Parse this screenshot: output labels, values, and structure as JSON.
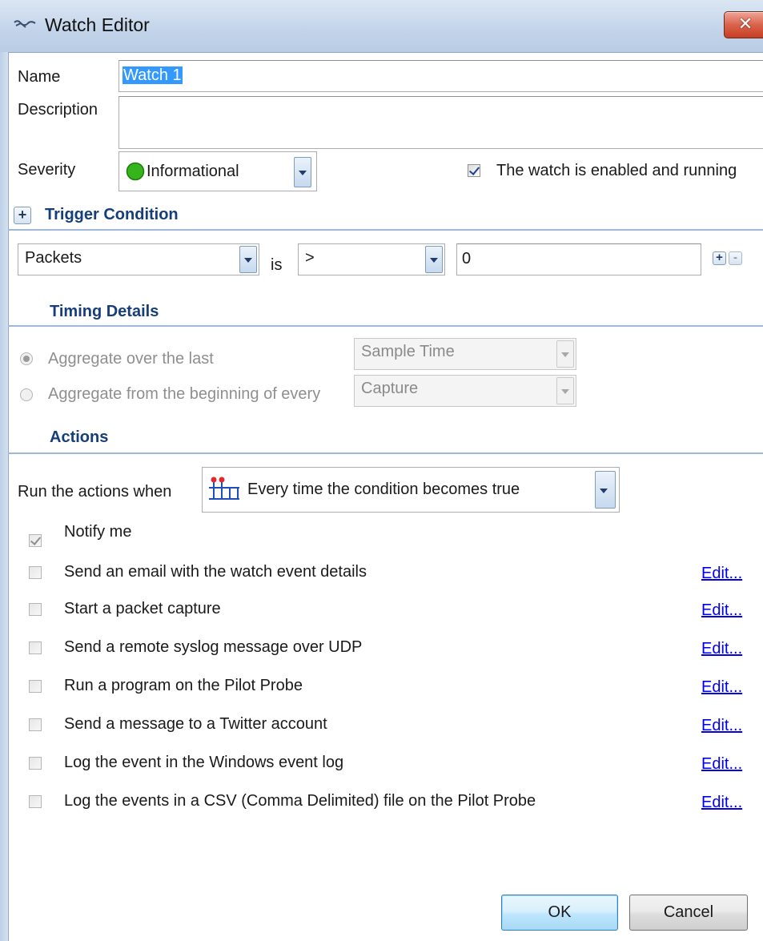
{
  "window": {
    "title": "Watch Editor",
    "close_glyph": "✕"
  },
  "form": {
    "name_label": "Name",
    "name_value": "Watch 1",
    "description_label": "Description",
    "description_value": "",
    "severity_label": "Severity",
    "severity_value": "Informational",
    "severity_color": "#2ea816",
    "enabled_label": "The watch is enabled and running",
    "enabled_checked": true
  },
  "trigger": {
    "toggle_glyph": "+",
    "title": "Trigger Condition",
    "field_value": "Packets",
    "is_label": "is",
    "operator_value": ">",
    "threshold_value": "0",
    "add_glyph": "+",
    "remove_glyph": "-"
  },
  "timing": {
    "title": "Timing Details",
    "option1_label": "Aggregate over the last",
    "option1_value": "Sample Time",
    "option1_selected": true,
    "option2_label": "Aggregate from the beginning of every",
    "option2_value": "Capture",
    "option2_selected": false
  },
  "actions": {
    "title": "Actions",
    "run_when_label": "Run the actions when",
    "run_when_value": "Every time the condition becomes true",
    "notify_label": "Notify me",
    "notify_checked": true,
    "edit_label": "Edit...",
    "items": [
      {
        "label": "Send an email with the watch event details",
        "checked": false
      },
      {
        "label": "Start a packet capture",
        "checked": false
      },
      {
        "label": "Send a remote syslog message over UDP",
        "checked": false
      },
      {
        "label": "Run a program on the Pilot Probe",
        "checked": false
      },
      {
        "label": "Send a message to a Twitter account",
        "checked": false
      },
      {
        "label": "Log the event in the Windows event log",
        "checked": false
      },
      {
        "label": "Log the events in a CSV (Comma Delimited) file on the Pilot Probe",
        "checked": false
      }
    ]
  },
  "buttons": {
    "ok": "OK",
    "cancel": "Cancel"
  },
  "icons": {
    "title": "watch-glasses-icon",
    "severity": "green-circle-icon",
    "run_when": "timeline-pins-icon"
  }
}
